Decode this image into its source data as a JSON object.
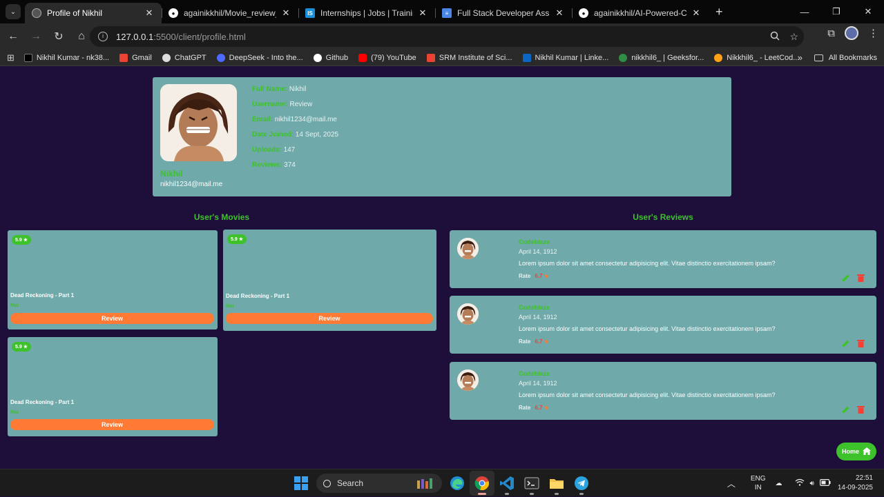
{
  "browser": {
    "tabs": [
      {
        "title": "Profile of Nikhil",
        "active": true
      },
      {
        "title": "againikkhil/Movie_review_platfo",
        "active": false
      },
      {
        "title": "Internships | Jobs | Trainings & |",
        "active": false
      },
      {
        "title": "Full Stack Developer Assignmen",
        "active": false
      },
      {
        "title": "againikkhil/AI-Powered-Collabo",
        "active": false
      }
    ],
    "url_host": "127.0.0.1",
    "url_path": ":5500/client/profile.html",
    "bookmarks": [
      "Nikhil Kumar - nk38...",
      "Gmail",
      "ChatGPT",
      "DeepSeek - Into the...",
      "Github",
      "(79) YouTube",
      "SRM Institute of Sci...",
      "Nikhil Kumar | Linke...",
      "nikkhil6_ | Geeksfor...",
      "Nikkhil6_ - LeetCod..."
    ],
    "all_bookmarks": "All Bookmarks"
  },
  "profile": {
    "name": "Nikhil",
    "email": "nikhil1234@mail.me",
    "fields": [
      {
        "key": "Full Name:",
        "value": "Nikhil"
      },
      {
        "key": "Username:",
        "value": "Review"
      },
      {
        "key": "Email:",
        "value": "nikhil1234@mail.me"
      },
      {
        "key": "Date Joined:",
        "value": "14 Sept, 2025"
      },
      {
        "key": "Uploads:",
        "value": "147"
      },
      {
        "key": "Reviews:",
        "value": "374"
      }
    ]
  },
  "movies_section": {
    "title": "User's Movies",
    "items": [
      {
        "rating": "5.9",
        "title": "Dead Reckoning - Part 1",
        "genre": "Mat",
        "button": "Review"
      },
      {
        "rating": "5.9",
        "title": "Dead Reckoning - Part 1",
        "genre": "Mat",
        "button": "Review"
      },
      {
        "rating": "5.9",
        "title": "Dead Reckoning - Part 1",
        "genre": "Mat",
        "button": "Review"
      }
    ]
  },
  "reviews_section": {
    "title": "User's Reviews",
    "items": [
      {
        "user": "Codeblaze",
        "date": "April 14, 1912",
        "text": "Lorem ipsum dolor sit amet consectetur adipisicing elit. Vitae distinctio exercitationem ipsam?",
        "rate_label": "Rate",
        "rate": "6.7"
      },
      {
        "user": "Codeblaze",
        "date": "April 14, 1912",
        "text": "Lorem ipsum dolor sit amet consectetur adipisicing elit. Vitae distinctio exercitationem ipsam?",
        "rate_label": "Rate",
        "rate": "6.7"
      },
      {
        "user": "Codeblaze",
        "date": "April 14, 1912",
        "text": "Lorem ipsum dolor sit amet consectetur adipisicing elit. Vitae distinctio exercitationem ipsam?",
        "rate_label": "Rate",
        "rate": "6.7"
      }
    ]
  },
  "home_button": "Home",
  "taskbar": {
    "search": "Search",
    "lang_1": "ENG",
    "lang_2": "IN",
    "time": "22:51",
    "date": "14-09-2025"
  },
  "colors": {
    "page_bg": "#1d0f3a",
    "card_bg": "#6fa9aa",
    "accent_green": "#3ec22b",
    "button_orange": "#ff7a35",
    "rate_red": "#ff3b30"
  }
}
